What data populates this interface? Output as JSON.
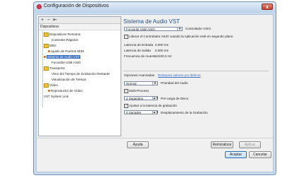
{
  "window": {
    "title": "Configuración de Dispositivos",
    "close_label": "x"
  },
  "toolbar": {
    "add_label": "+",
    "remove_label": "−",
    "reset_label": "⇤"
  },
  "tree": {
    "header": "Dispositivos",
    "items": [
      {
        "label": "Dispositivos Remotos"
      },
      {
        "label": "Controles Rápidos"
      },
      {
        "label": "MIDI"
      },
      {
        "label": "Ajuste de Puertos MIDI"
      },
      {
        "label": "Sistema de Audio VST"
      },
      {
        "label": "Focusrite USB ASIO"
      },
      {
        "label": "Transporte"
      },
      {
        "label": "Visor del Tiempo de Grabación Restante"
      },
      {
        "label": "Visualización de Tiempo"
      },
      {
        "label": "Vídeo"
      },
      {
        "label": "Reproductor de Vídeo"
      },
      {
        "label": "VST System Link"
      }
    ]
  },
  "panel": {
    "title": "Sistema de Audio VST",
    "driver_value": "Focusrite USB ASIO",
    "driver_label": "Controlador ASIO",
    "release_driver_label": "Liberar el Controlador ASIO cuando la Aplicación esté en segundo plano",
    "input_latency_label": "Latencia de Entrada",
    "input_latency_value": "0.000 ms",
    "output_latency_label": "Latencia de Salida",
    "output_latency_value": "0.000 ms",
    "sample_rate_label": "Frecuencia de muestr.",
    "sample_rate_value": "44100.0 Hz",
    "advanced_label": "Opciones Avanzadas",
    "restore_label": "Restaurar valores por defecto",
    "priority_value": "Normal",
    "priority_label": "Prioridad del Audio",
    "multiprocess_label": "Multi-Proceso",
    "preload_value": "2 Segundos",
    "preload_label": "Pre-carga de Disco",
    "adjust_latency_label": "Ajustar a la latencia de grabación",
    "offset_value": "0 Samples",
    "offset_label": "Desplazamiento de la Grabación"
  },
  "buttons": {
    "help": "Ayuda",
    "reset": "Reinicializar",
    "apply": "Aplicar",
    "accept": "Aceptar",
    "cancel": "Cancelar"
  }
}
